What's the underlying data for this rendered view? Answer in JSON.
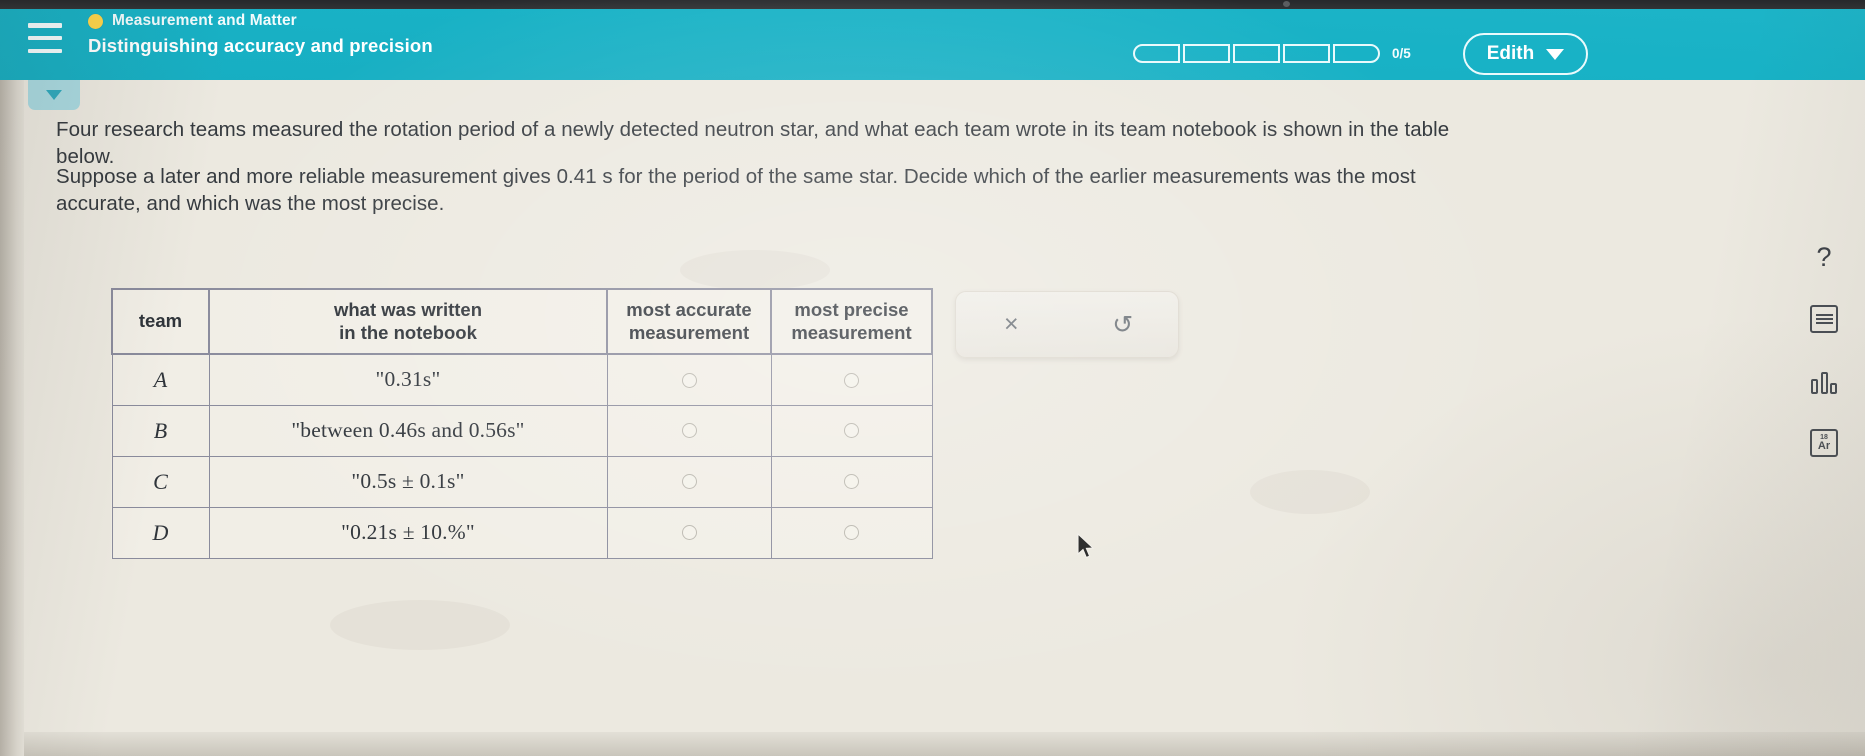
{
  "header": {
    "menu_icon": "hamburger-icon",
    "breadcrumb_dot": "orange-dot-icon",
    "breadcrumb": "Measurement and Matter",
    "title": "Distinguishing accuracy and precision",
    "progress_count": "0/5",
    "progress_segments": 5,
    "progress_filled": 0,
    "user_name": "Edith",
    "user_chevron": "chevron-down-icon",
    "bg_color": "#18b2c6",
    "dot_color": "#ffd54a"
  },
  "collapse": {
    "icon": "chevron-down-icon"
  },
  "question": {
    "paragraph1": "Four research teams measured the rotation period of a newly detected neutron star, and what each team wrote in its team notebook is shown in the table below.",
    "paragraph2": "Suppose a later and more reliable measurement gives 0.41 s for the period of the same star. Decide which of the earlier measurements was the most accurate, and which was the most precise."
  },
  "table": {
    "headers": {
      "team": "team",
      "written_line1": "what was written",
      "written_line2": "in the notebook",
      "accurate_line1": "most accurate",
      "accurate_line2": "measurement",
      "precise_line1": "most precise",
      "precise_line2": "measurement"
    },
    "rows": [
      {
        "team": "A",
        "written": "\"0.31s\"",
        "most_accurate_selected": false,
        "most_precise_selected": false
      },
      {
        "team": "B",
        "written": "\"between 0.46s and 0.56s\"",
        "most_accurate_selected": false,
        "most_precise_selected": false
      },
      {
        "team": "C",
        "written": "\"0.5s ± 0.1s\"",
        "most_accurate_selected": false,
        "most_precise_selected": false
      },
      {
        "team": "D",
        "written": "\"0.21s ± 10.%\"",
        "most_accurate_selected": false,
        "most_precise_selected": false
      }
    ]
  },
  "actions": {
    "clear_icon": "x-close-icon",
    "clear_label": "×",
    "undo_icon": "undo-arrow-icon",
    "undo_label": "↺"
  },
  "toolbar": {
    "items": [
      {
        "icon": "question-mark-icon",
        "label": "?"
      },
      {
        "icon": "periodic-table-icon",
        "label": ""
      },
      {
        "icon": "bar-chart-icon",
        "label": ""
      },
      {
        "icon": "element-tile-icon",
        "label": "Ar",
        "number": "18"
      }
    ]
  },
  "cursor": {
    "icon": "mouse-pointer-icon"
  }
}
